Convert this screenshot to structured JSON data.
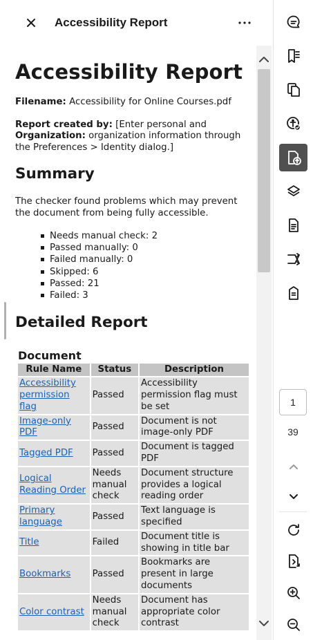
{
  "panel": {
    "title": "Accessibility Report"
  },
  "report": {
    "heading": "Accessibility Report",
    "filename_label": "Filename:",
    "filename_value": "Accessibility for Online Courses.pdf",
    "created_label": "Report created by:",
    "created_value": "[Enter personal and",
    "org_label": "Organization:",
    "org_value": "organization information through the Preferences > Identity dialog.]",
    "summary_heading": "Summary",
    "summary_text": "The checker found problems which may prevent the document from being fully accessible.",
    "summary_items": [
      "Needs manual check: 2",
      "Passed manually: 0",
      "Failed manually: 0",
      "Skipped: 6",
      "Passed: 21",
      "Failed: 3"
    ],
    "detail_heading": "Detailed Report",
    "table_caption": "Document",
    "columns": [
      "Rule Name",
      "Status",
      "Description"
    ],
    "rows": [
      {
        "rule": "Accessibility permission flag",
        "status": "Passed",
        "desc": "Accessibility permission flag must be set"
      },
      {
        "rule": "Image-only PDF",
        "status": "Passed",
        "desc": "Document is not image-only PDF"
      },
      {
        "rule": "Tagged PDF",
        "status": "Passed",
        "desc": "Document is tagged PDF"
      },
      {
        "rule": "Logical Reading Order",
        "status": "Needs manual check",
        "desc": "Document structure provides a logical reading order"
      },
      {
        "rule": "Primary language",
        "status": "Passed",
        "desc": "Text language is specified"
      },
      {
        "rule": "Title",
        "status": "Failed",
        "desc": "Document title is showing in title bar"
      },
      {
        "rule": "Bookmarks",
        "status": "Passed",
        "desc": "Bookmarks are present in large documents"
      },
      {
        "rule": "Color contrast",
        "status": "Needs manual check",
        "desc": "Document has appropriate color contrast"
      }
    ]
  },
  "pagination": {
    "current": "1",
    "total": "39"
  },
  "rail_icons": [
    "comment-icon",
    "bookmarks-icon",
    "pages-icon",
    "accessibility-check-icon",
    "accessibility-report-icon",
    "layers-icon",
    "document-icon",
    "compare-icon",
    "tag-icon"
  ],
  "colors": {
    "link": "#1a61b8",
    "header_cell": "#c4c4c4",
    "body_cell": "#e0e0e0",
    "active_rail": "#505050"
  }
}
